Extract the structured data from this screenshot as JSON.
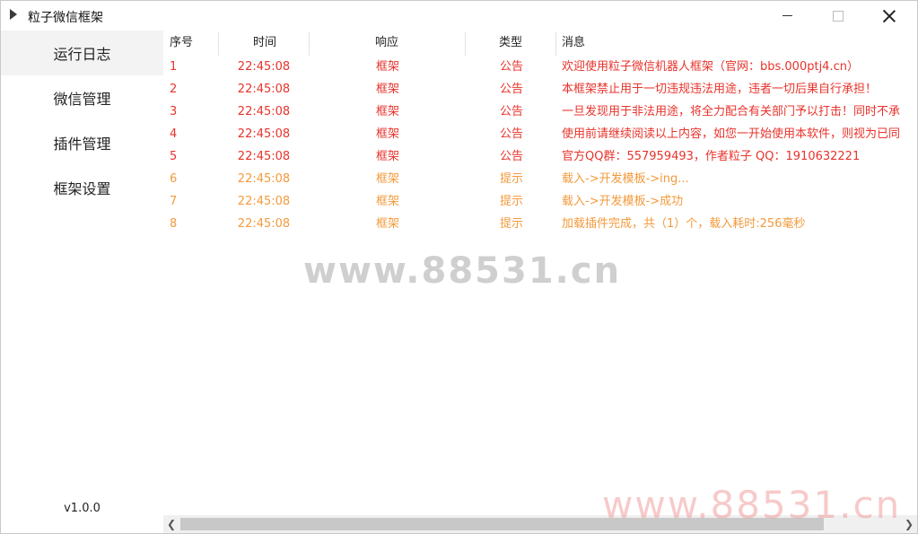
{
  "window": {
    "title": "粒子微信框架"
  },
  "sidebar": {
    "items": [
      {
        "label": "运行日志",
        "active": true
      },
      {
        "label": "微信管理",
        "active": false
      },
      {
        "label": "插件管理",
        "active": false
      },
      {
        "label": "框架设置",
        "active": false
      }
    ],
    "version": "v1.0.0"
  },
  "table": {
    "columns": [
      "序号",
      "时间",
      "响应",
      "类型",
      "消息"
    ],
    "rows": [
      {
        "no": "1",
        "time": "22:45:08",
        "response": "框架",
        "type": "公告",
        "message": "欢迎使用粒子微信机器人框架（官网：bbs.000ptj4.cn）",
        "color": "#e8332b"
      },
      {
        "no": "2",
        "time": "22:45:08",
        "response": "框架",
        "type": "公告",
        "message": "本框架禁止用于一切违规违法用途，违者一切后果自行承担！",
        "color": "#e8332b"
      },
      {
        "no": "3",
        "time": "22:45:08",
        "response": "框架",
        "type": "公告",
        "message": "一旦发现用于非法用途，将全力配合有关部门予以打击！同时不承",
        "color": "#e8332b"
      },
      {
        "no": "4",
        "time": "22:45:08",
        "response": "框架",
        "type": "公告",
        "message": "使用前请继续阅读以上内容，如您一开始使用本软件，则视为已同",
        "color": "#e8332b"
      },
      {
        "no": "5",
        "time": "22:45:08",
        "response": "框架",
        "type": "公告",
        "message": "官方QQ群：557959493，作者粒子 QQ：1910632221",
        "color": "#e8332b"
      },
      {
        "no": "6",
        "time": "22:45:08",
        "response": "框架",
        "type": "提示",
        "message": "载入->开发模板->ing...",
        "color": "#f39a3c"
      },
      {
        "no": "7",
        "time": "22:45:08",
        "response": "框架",
        "type": "提示",
        "message": "载入->开发模板->成功",
        "color": "#f39a3c"
      },
      {
        "no": "8",
        "time": "22:45:08",
        "response": "框架",
        "type": "提示",
        "message": "加载插件完成，共（1）个，载入耗时:256毫秒",
        "color": "#f39a3c"
      }
    ]
  },
  "watermarks": {
    "center": "www.88531.cn",
    "corner": "www.88531.cn"
  }
}
